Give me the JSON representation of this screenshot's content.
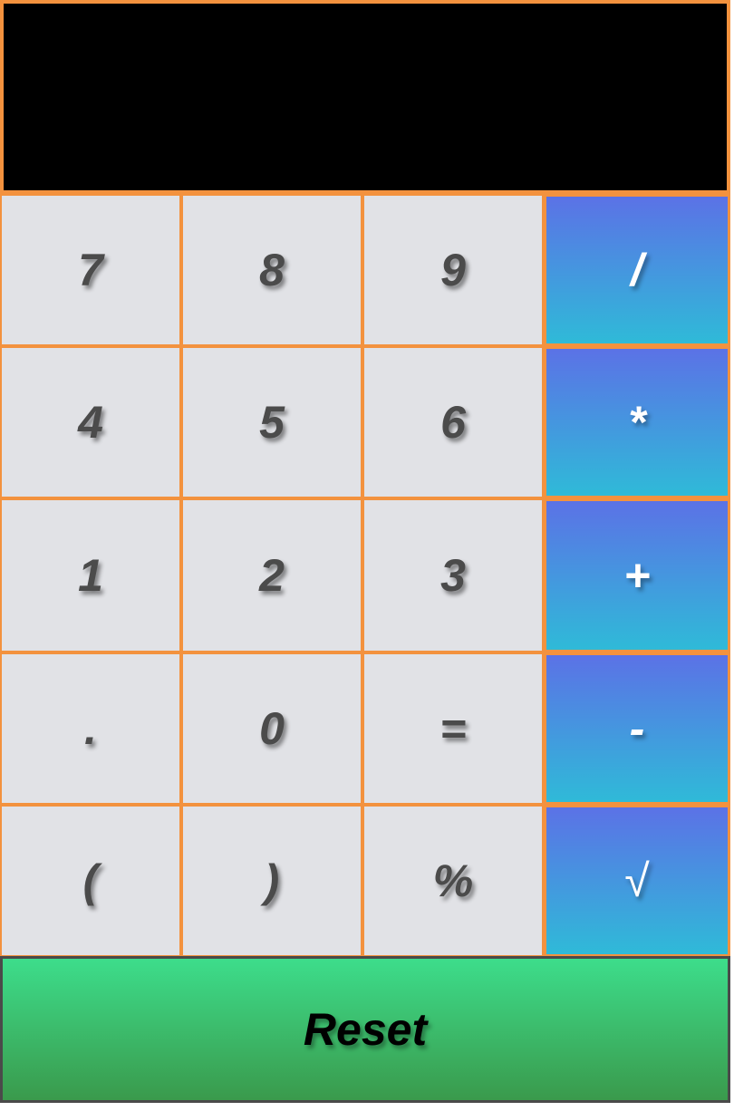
{
  "display": {
    "value": ""
  },
  "keys": {
    "k7": "7",
    "k8": "8",
    "k9": "9",
    "divide": "/",
    "k4": "4",
    "k5": "5",
    "k6": "6",
    "multiply": "*",
    "k1": "1",
    "k2": "2",
    "k3": "3",
    "plus": "+",
    "decimal": ".",
    "k0": "0",
    "equals": "=",
    "minus": "-",
    "lparen": "(",
    "rparen": ")",
    "percent": "%",
    "sqrt": "√"
  },
  "reset_label": "Reset",
  "colors": {
    "border_accent": "#f3923e",
    "number_key_bg": "#e1e2e6",
    "number_key_text": "#4b4b4b",
    "operator_gradient_top": "#5b72e6",
    "operator_gradient_bottom": "#2fbad8",
    "reset_gradient_top": "#3ddd8b",
    "reset_gradient_bottom": "#3a9a4c",
    "display_bg": "#000000"
  }
}
